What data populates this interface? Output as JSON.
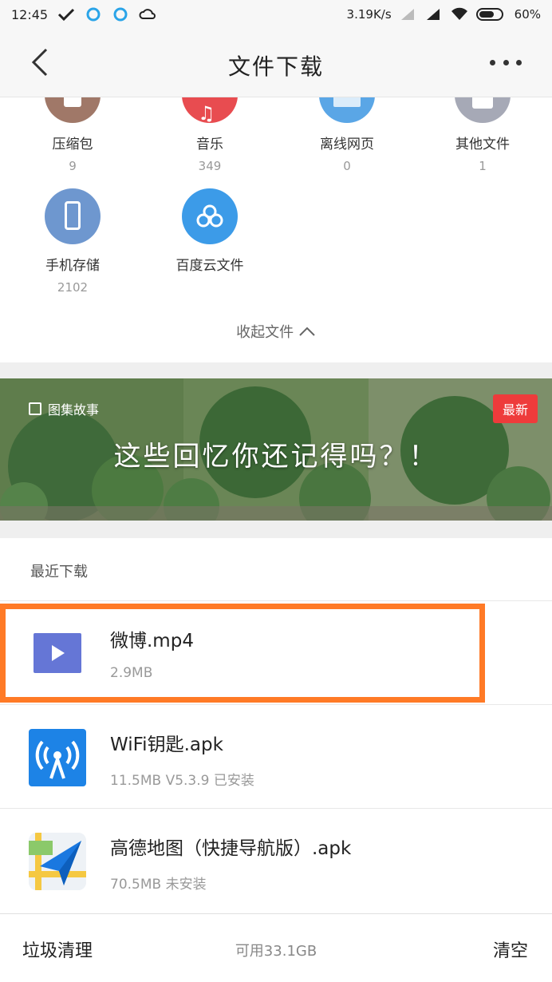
{
  "status_bar": {
    "time": "12:45",
    "net_speed": "3.19K/s",
    "battery": "60%"
  },
  "header": {
    "title": "文件下载"
  },
  "categories": [
    {
      "label": "压缩包",
      "count": "9",
      "color": "#a07868",
      "icon": "zip-icon"
    },
    {
      "label": "音乐",
      "count": "349",
      "color": "#e84c50",
      "icon": "music-icon"
    },
    {
      "label": "离线网页",
      "count": "0",
      "color": "#5aa6e6",
      "icon": "webpage-icon"
    },
    {
      "label": "其他文件",
      "count": "1",
      "color": "#a6a9b6",
      "icon": "file-icon"
    },
    {
      "label": "手机存储",
      "count": "2102",
      "color": "#6e97cf",
      "icon": "phone-icon"
    },
    {
      "label": "百度云文件",
      "count": "",
      "color": "#3c9be8",
      "icon": "cloud-icon"
    }
  ],
  "collapse_label": "收起文件",
  "banner": {
    "tag": "图集故事",
    "badge": "最新",
    "text": "这些回忆你还记得吗？！"
  },
  "recent": {
    "header": "最近下载",
    "items": [
      {
        "name": "微博.mp4",
        "meta": "2.9MB",
        "icon": "video-icon"
      },
      {
        "name": "WiFi钥匙.apk",
        "meta": "11.5MB  V5.3.9 已安装",
        "icon": "wifi-icon"
      },
      {
        "name": "高德地图（快捷导航版）.apk",
        "meta": "70.5MB  未安装",
        "icon": "map-icon"
      }
    ]
  },
  "bottom_bar": {
    "left": "垃圾清理",
    "middle": "可用33.1GB",
    "right": "清空"
  },
  "colors": {
    "highlight": "#ff7a26",
    "badge": "#ee3b3b"
  }
}
